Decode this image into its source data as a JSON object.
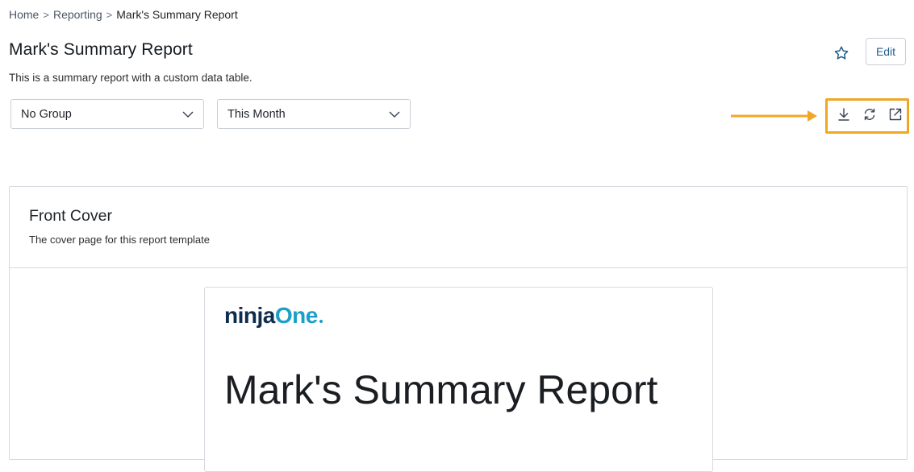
{
  "breadcrumb": {
    "items": [
      "Home",
      "Reporting",
      "Mark's Summary Report"
    ],
    "separator": ">"
  },
  "header": {
    "title": "Mark's Summary Report",
    "description": "This is a summary report with a custom data table.",
    "favorite_icon": "star-icon",
    "edit_label": "Edit"
  },
  "filters": {
    "group": {
      "selected": "No Group",
      "icon": "chevron-down-icon"
    },
    "date_range": {
      "selected": "This Month",
      "icon": "chevron-down-icon"
    }
  },
  "toolbar": {
    "icons": [
      "download-icon",
      "refresh-icon",
      "open-external-icon"
    ],
    "highlight_color": "#f0a726"
  },
  "report": {
    "section_title": "Front Cover",
    "section_description": "The cover page for this report template",
    "cover": {
      "logo_text_part1": "ninja",
      "logo_text_part2": "One",
      "title": "Mark's Summary Report"
    }
  },
  "colors": {
    "accent": "#1f5f8b",
    "logo_dark": "#0e2c4c",
    "logo_light": "#1a9fc8"
  }
}
